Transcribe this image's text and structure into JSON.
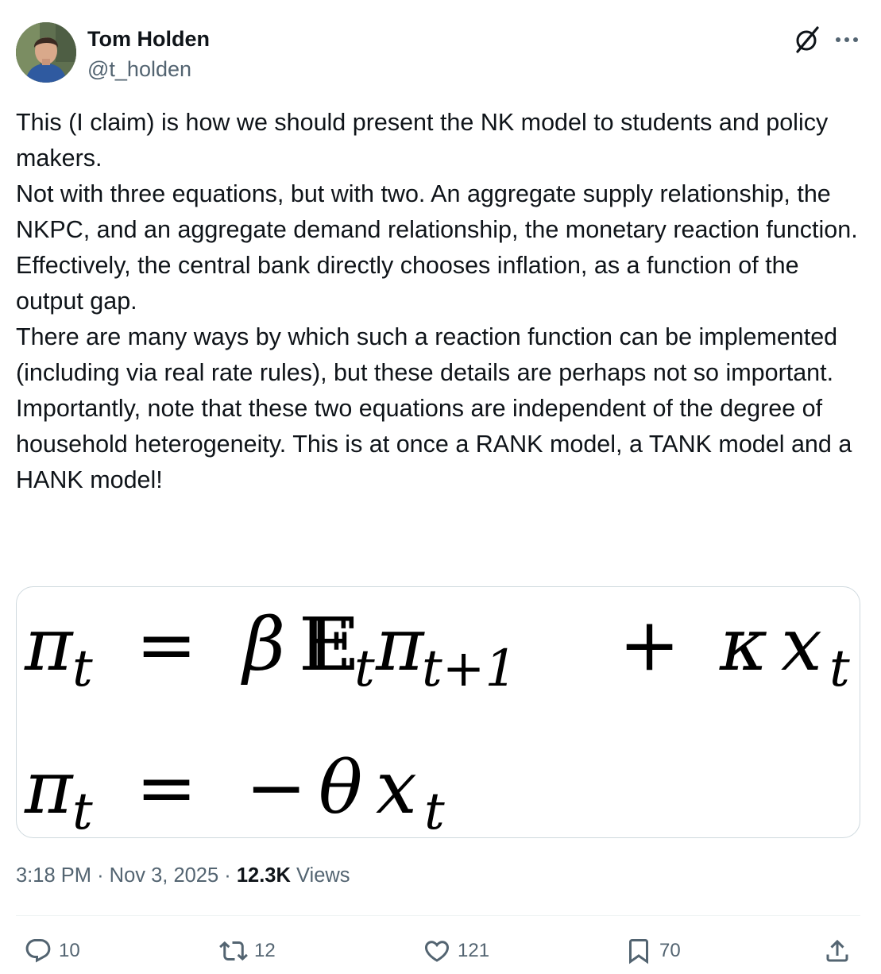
{
  "author": {
    "name": "Tom Holden",
    "handle": "@t_holden"
  },
  "tweet": {
    "paragraphs": [
      "This (I claim) is how we should present the NK model to students and policy makers.",
      "Not with three equations, but with two. An aggregate supply relationship, the NKPC, and an aggregate demand relationship, the monetary reaction function.",
      "Effectively, the central bank directly chooses inflation, as a function of the output gap.",
      "There are many ways by which such a reaction function can be implemented (including via real rate rules), but these details are perhaps not so important.",
      "Importantly, note that these two equations are independent of the degree of household heterogeneity. This is at once a RANK model, a TANK model and a HANK model!"
    ]
  },
  "equations": {
    "eq1": {
      "lhs": "π",
      "lhs_sub": "t",
      "equals": "=",
      "beta": "β",
      "expect": "E",
      "expect_sub": "t",
      "pi": "π",
      "pi_sub": "t+1",
      "plus": "+",
      "kappa": "κ",
      "x": "x",
      "x_sub": "t"
    },
    "eq2": {
      "lhs": "π",
      "lhs_sub": "t",
      "equals": "=",
      "minus": "−",
      "theta": "θ",
      "x": "x",
      "x_sub": "t"
    }
  },
  "meta": {
    "time": "3:18 PM",
    "separator": "·",
    "date": "Nov 3, 2025",
    "views_count": "12.3K",
    "views_label": "Views"
  },
  "actions": {
    "replies": "10",
    "reposts": "12",
    "likes": "121",
    "bookmarks": "70"
  },
  "icons": {
    "grok": "grok-slash-icon",
    "more": "more-icon",
    "reply": "reply-icon",
    "repost": "repost-icon",
    "like": "like-icon",
    "bookmark": "bookmark-icon",
    "share": "share-icon"
  },
  "colors": {
    "text": "#0f1419",
    "secondary": "#536471",
    "border": "#cfd9de"
  }
}
